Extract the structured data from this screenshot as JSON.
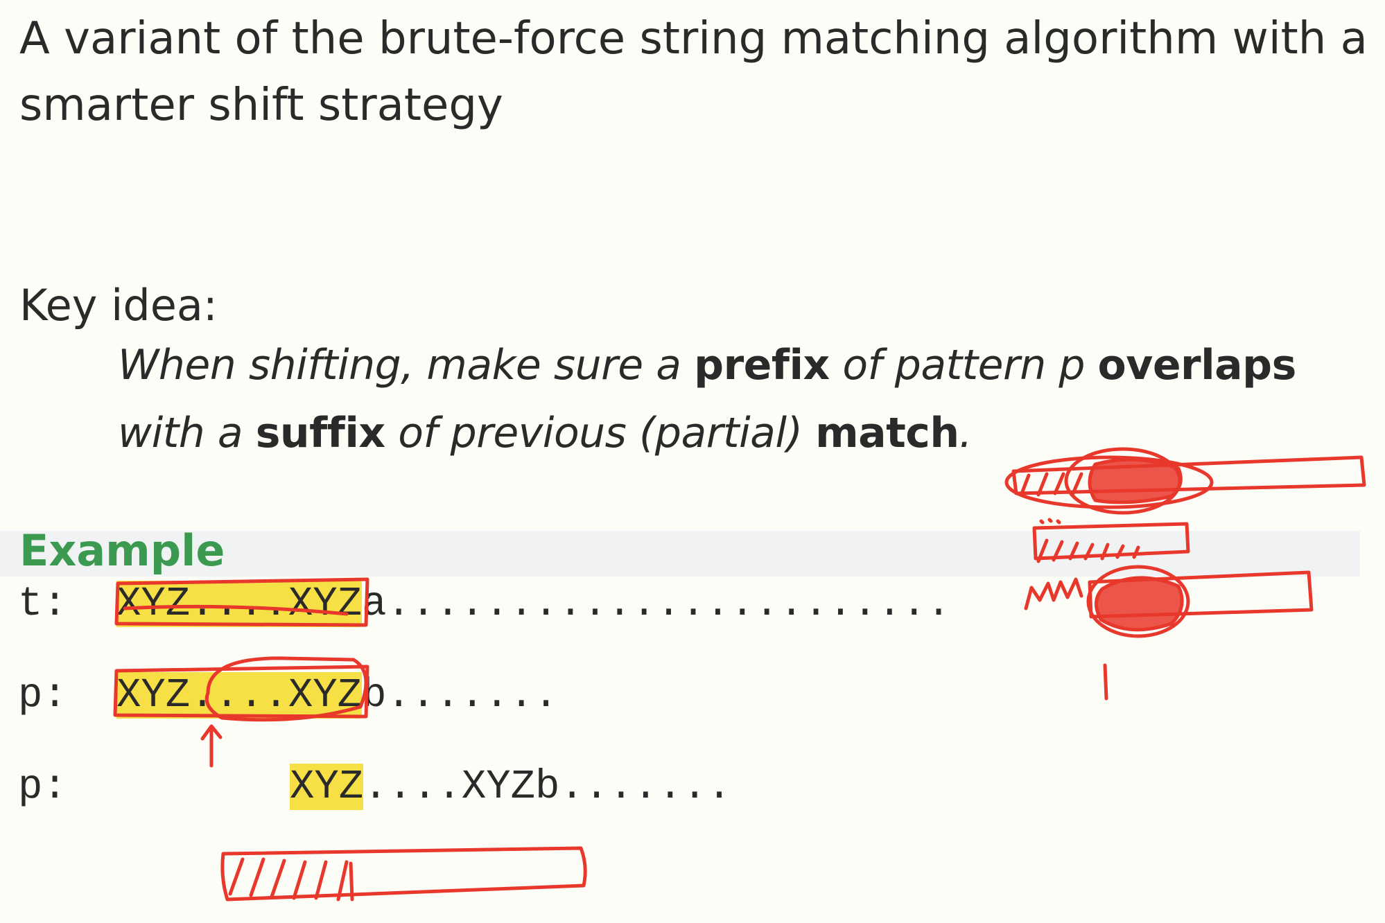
{
  "intro": {
    "line1": "A variant of the brute-force string matching algorithm with a",
    "line2": "smarter shift strategy"
  },
  "key_idea": {
    "label": "Key idea:",
    "line1": {
      "p1": "When shifting, make sure a ",
      "b1": "prefix",
      "p2": " of pattern ",
      "p3": "p",
      "p4": " ",
      "b2": "overlaps"
    },
    "line2": {
      "p1": "with a ",
      "b1": "suffix",
      "p2": " of previous (partial) ",
      "b2": "match",
      "p3": "."
    }
  },
  "example": {
    "label": "Example",
    "rows": [
      {
        "label": "t:",
        "highlight": "XYZ....XYZ",
        "rest": "a......................."
      },
      {
        "label": "p:",
        "highlight": "XYZ....XYZ",
        "rest": "b......."
      },
      {
        "label": "p:",
        "highlight": "XYZ",
        "rest": "....XYZb......."
      }
    ]
  },
  "colors": {
    "highlight": "#f7e046",
    "ink": "#e8372b",
    "example_heading": "#3b9a4f"
  }
}
